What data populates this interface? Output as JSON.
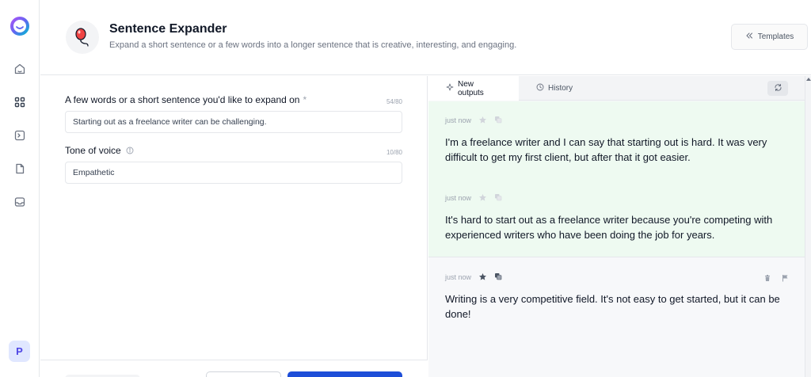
{
  "app": {
    "title": "Sentence Expander",
    "subtitle": "Expand a short sentence or a few words into a longer sentence that is creative, interesting, and engaging.",
    "templates_label": "Templates"
  },
  "sidebar": {
    "items": [
      {
        "icon": "home-icon"
      },
      {
        "icon": "grid-icon"
      },
      {
        "icon": "terminal-icon"
      },
      {
        "icon": "document-icon"
      },
      {
        "icon": "inbox-icon"
      }
    ],
    "avatar_initial": "P"
  },
  "form": {
    "field1": {
      "label": "A few words or a short sentence you'd like to expand on",
      "required_mark": "*",
      "counter": "54/80",
      "value": "Starting out as a freelance writer can be challenging."
    },
    "field2": {
      "label": "Tone of voice",
      "counter": "10/80",
      "value": "Empathetic"
    }
  },
  "outputs": {
    "tabs": [
      {
        "label": "New outputs",
        "icon": "sparkle-icon",
        "active": true
      },
      {
        "label": "History",
        "icon": "clock-icon",
        "active": false
      }
    ],
    "items": [
      {
        "time": "just now",
        "text": "I'm a freelance writer and I can say that starting out is hard. It was very difficult to get my first client, but after that it got easier."
      },
      {
        "time": "just now",
        "text": "It's hard to start out as a freelance writer because you're competing with experienced writers who have been doing the job for years."
      },
      {
        "time": "just now",
        "text": "Writing is a very competitive field. It's not easy to get started, but it can be done!"
      }
    ]
  },
  "colors": {
    "accent": "#1d4ed8",
    "fresh_output_bg": "#eefaf1",
    "avatar_bg": "#e0e7ff"
  }
}
